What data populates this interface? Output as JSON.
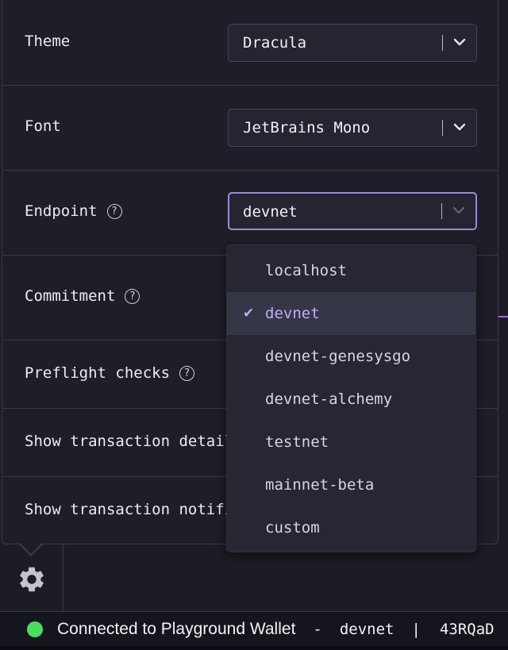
{
  "settings": {
    "theme": {
      "label": "Theme",
      "value": "Dracula"
    },
    "font": {
      "label": "Font",
      "value": "JetBrains Mono"
    },
    "endpoint": {
      "label": "Endpoint",
      "value": "devnet"
    },
    "commitment": {
      "label": "Commitment"
    },
    "preflight": {
      "label": "Preflight checks"
    },
    "tx_details": {
      "label": "Show transaction details"
    },
    "tx_notifications": {
      "label": "Show transaction notifications"
    }
  },
  "help_glyph": "?",
  "dropdown": {
    "selected_check": "✔",
    "options": [
      "localhost",
      "devnet",
      "devnet-genesysgo",
      "devnet-alchemy",
      "testnet",
      "mainnet-beta",
      "custom"
    ]
  },
  "status": {
    "connection_text": "Connected to Playground Wallet",
    "dash": "-",
    "network": "devnet",
    "pipe": "|",
    "address": "43RQaD"
  },
  "colors": {
    "accent": "#9b8ad8",
    "selected_text": "#c6a8ff",
    "status_dot": "#4ade60"
  }
}
